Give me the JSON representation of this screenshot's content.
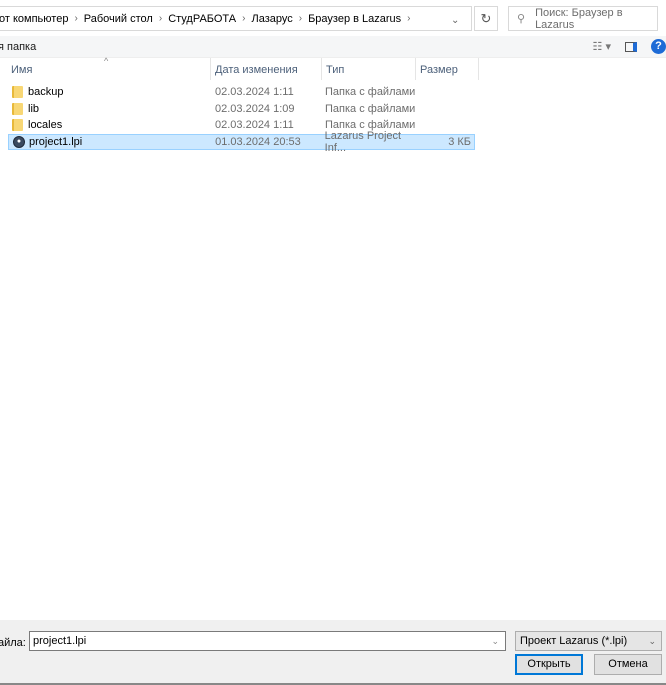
{
  "breadcrumb": [
    "от компьютер",
    "Рабочий стол",
    "СтудРАБОТА",
    "Лазарус",
    "Браузер в Lazarus"
  ],
  "search": {
    "placeholder": "Поиск: Браузер в Lazarus"
  },
  "toolbar": {
    "new_folder": "я папка"
  },
  "columns": [
    "Имя",
    "Дата изменения",
    "Тип",
    "Размер"
  ],
  "files": [
    {
      "name": "backup",
      "date": "02.03.2024 1:11",
      "type": "Папка с файлами",
      "size": "",
      "icon": "folder-icon"
    },
    {
      "name": "lib",
      "date": "02.03.2024 1:09",
      "type": "Папка с файлами",
      "size": "",
      "icon": "folder-icon"
    },
    {
      "name": "locales",
      "date": "02.03.2024 1:11",
      "type": "Папка с файлами",
      "size": "",
      "icon": "folder-icon"
    },
    {
      "name": "project1.lpi",
      "date": "01.03.2024 20:53",
      "type": "Lazarus Project Inf...",
      "size": "3 КБ",
      "icon": "lazarus-project-icon",
      "selected": true
    }
  ],
  "footer": {
    "filename_label": "айла:",
    "filename_value": "project1.lpi",
    "filter": "Проект Lazarus (*.lpi)",
    "open": "Открыть",
    "cancel": "Отмена"
  }
}
